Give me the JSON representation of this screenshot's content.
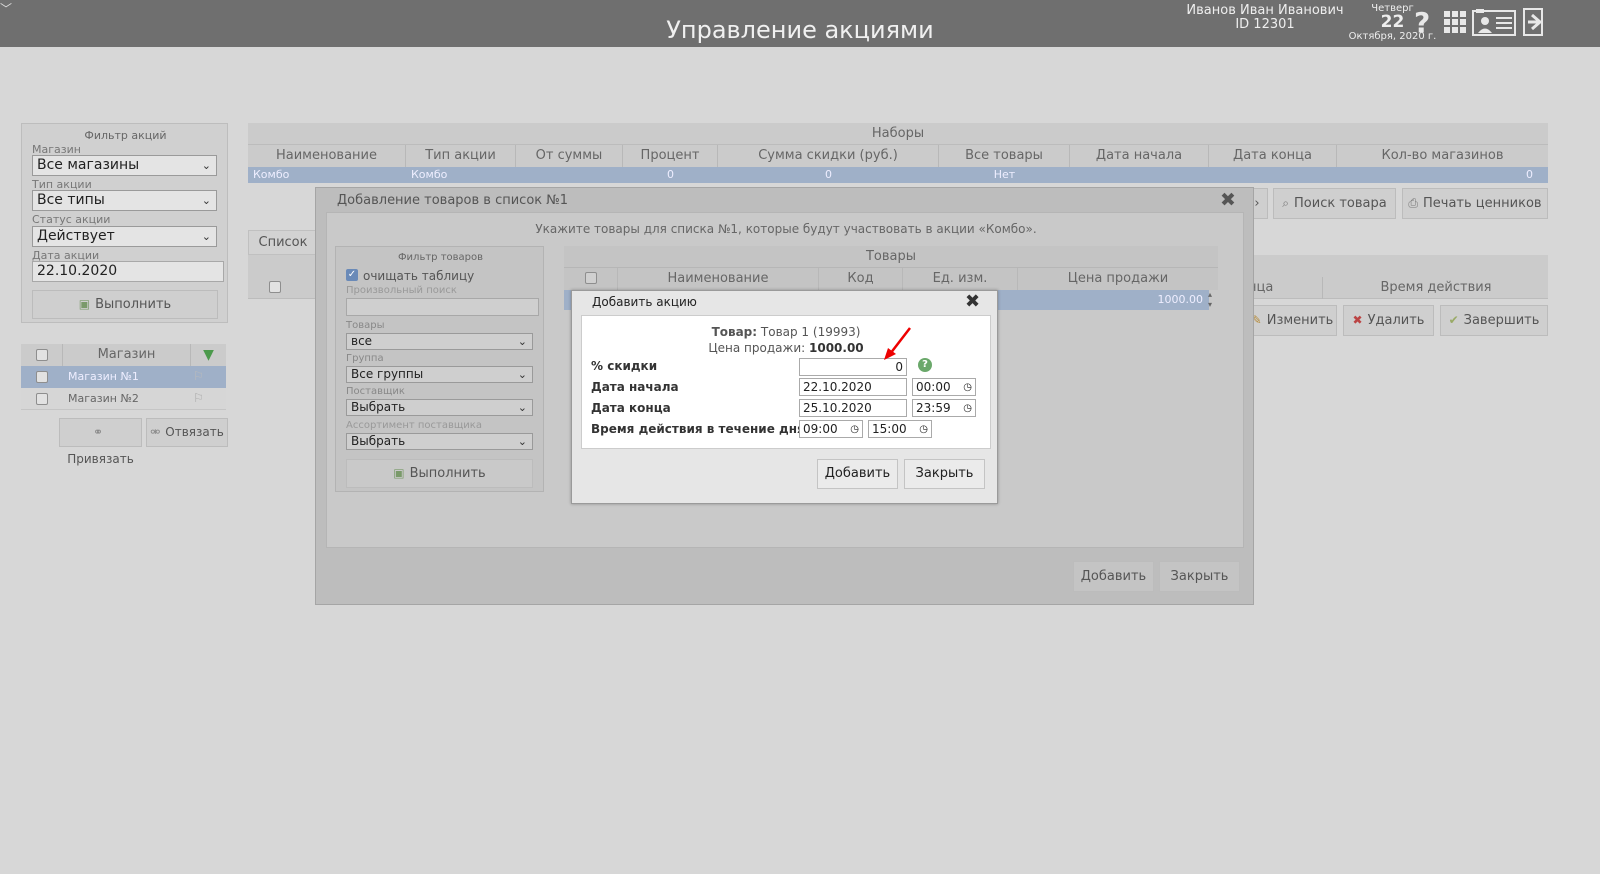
{
  "header": {
    "title": "Управление акциями",
    "user_name": "Иванов Иван Иванович",
    "user_id": "ID 12301",
    "weekday": "Четверг",
    "day": "22",
    "month_year": "Октября, 2020 г."
  },
  "filter": {
    "title": "Фильтр акций",
    "store_label": "Магазин",
    "store_value": "Все магазины",
    "type_label": "Тип акции",
    "type_value": "Все типы",
    "status_label": "Статус акции",
    "status_value": "Действует",
    "date_label": "Дата акции",
    "date_value": "22.10.2020",
    "run_label": "Выполнить"
  },
  "stores": {
    "header": "Магазин",
    "rows": [
      "Магазин №1",
      "Магазин №2"
    ],
    "bind_label": "Привязать",
    "unbind_label": "Отвязать"
  },
  "sets": {
    "title": "Наборы",
    "columns": [
      "Наименование",
      "Тип акции",
      "От суммы",
      "Процент",
      "Сумма скидки (руб.)",
      "Все товары",
      "Дата начала",
      "Дата конца",
      "Кол-во магазинов"
    ],
    "row": [
      "Комбо",
      "Комбо",
      "",
      "0",
      "0",
      "Нет",
      "",
      "",
      "0"
    ]
  },
  "actions": {
    "search_label": "Поиск товара",
    "print_label": "Печать ценников",
    "edit_label": "Изменить",
    "delete_label": "Удалить",
    "finish_label": "Завершить",
    "tab_list": "Список",
    "col_end_partial": "нца",
    "col_time": "Время действия"
  },
  "dialog1": {
    "title": "Добавление товаров в список №1",
    "instruction": "Укажите товары для списка №1, которые будут участвовать в акции «Комбо».",
    "filter_title": "Фильтр товаров",
    "clear_table_label": "очищать таблицу",
    "search_label": "Произвольный поиск",
    "goods_label": "Товары",
    "goods_value": "все",
    "group_label": "Группа",
    "group_value": "Все группы",
    "supplier_label": "Поставщик",
    "supplier_value": "Выбрать",
    "assortment_label": "Ассортимент поставщика",
    "assortment_value": "Выбрать",
    "run_label": "Выполнить",
    "goods_title": "Товары",
    "goods_columns": [
      "Наименование",
      "Код",
      "Ед. изм.",
      "Цена продажи"
    ],
    "goods_row_price": "1000.00",
    "add_label": "Добавить",
    "close_label": "Закрыть"
  },
  "dialog2": {
    "title": "Добавить акцию",
    "product_label": "Товар:",
    "product_value": "Товар 1 (19993)",
    "price_label": "Цена продажи:",
    "price_value": "1000.00",
    "discount_label": "% скидки",
    "discount_value": "0",
    "start_label": "Дата начала",
    "start_date": "22.10.2020",
    "start_time": "00:00",
    "end_label": "Дата конца",
    "end_date": "25.10.2020",
    "end_time": "23:59",
    "daytime_label": "Время действия в течение дня",
    "daytime_from": "09:00",
    "daytime_to": "15:00",
    "add_label": "Добавить",
    "close_label": "Закрыть"
  }
}
